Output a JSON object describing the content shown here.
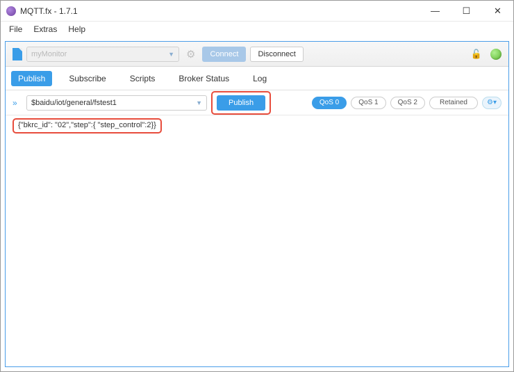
{
  "window": {
    "title": "MQTT.fx - 1.7.1"
  },
  "menu": {
    "file": "File",
    "extras": "Extras",
    "help": "Help"
  },
  "connection": {
    "profile": "myMonitor",
    "connect": "Connect",
    "disconnect": "Disconnect"
  },
  "tabs": {
    "publish": "Publish",
    "subscribe": "Subscribe",
    "scripts": "Scripts",
    "broker_status": "Broker Status",
    "log": "Log"
  },
  "publish": {
    "topic": "$baidu/iot/general/fstest1",
    "button": "Publish",
    "payload": "{\"bkrc_id\": \"02\",\"step\":{ \"step_control\":2}}"
  },
  "qos": {
    "qos0": "QoS 0",
    "qos1": "QoS 1",
    "qos2": "QoS 2",
    "retained": "Retained"
  }
}
